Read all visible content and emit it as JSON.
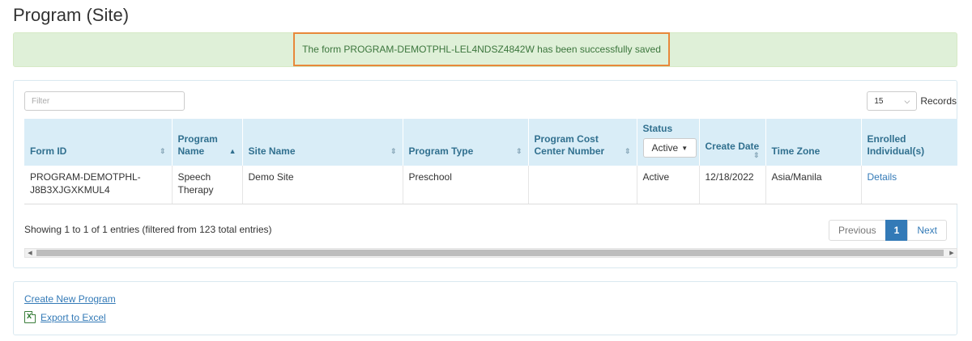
{
  "page": {
    "title": "Program (Site)"
  },
  "alert": {
    "message": "The form PROGRAM-DEMOTPHL-LEL4NDSZ4842W has been successfully saved"
  },
  "controls": {
    "filter_placeholder": "Filter",
    "records_value": "15",
    "records_label": "Records"
  },
  "table": {
    "columns": [
      {
        "label": "Form ID",
        "sort": "both"
      },
      {
        "label": "Program Name",
        "sort": "asc"
      },
      {
        "label": "Site Name",
        "sort": "both"
      },
      {
        "label": "Program Type",
        "sort": "both"
      },
      {
        "label": "Program Cost Center Number",
        "sort": "both"
      },
      {
        "label": "Status",
        "sort": "none"
      },
      {
        "label": "Create Date",
        "sort": "both"
      },
      {
        "label": "Time Zone",
        "sort": "none"
      },
      {
        "label": "Enrolled Individual(s)",
        "sort": "none"
      }
    ],
    "status_filter": "Active",
    "rows": [
      {
        "form_id": "PROGRAM-DEMOTPHL-J8B3XJGXKMUL4",
        "program_name": "Speech Therapy",
        "site_name": "Demo Site",
        "program_type": "Preschool",
        "cost_center": "",
        "status": "Active",
        "create_date": "12/18/2022",
        "time_zone": "Asia/Manila",
        "enrolled": "Details"
      }
    ]
  },
  "footer": {
    "info": "Showing 1 to 1 of 1 entries (filtered from 123 total entries)",
    "prev": "Previous",
    "page": "1",
    "next": "Next"
  },
  "actions": {
    "create": "Create New Program",
    "export": "Export to Excel"
  },
  "icons": {
    "sort": "sort-both-icon",
    "sort_asc": "sort-asc-icon",
    "excel": "excel-icon"
  },
  "colors": {
    "alert_bg": "#dff0d8",
    "alert_highlight": "#e8883a",
    "header_bg": "#d9edf7",
    "link": "#337ab7"
  }
}
